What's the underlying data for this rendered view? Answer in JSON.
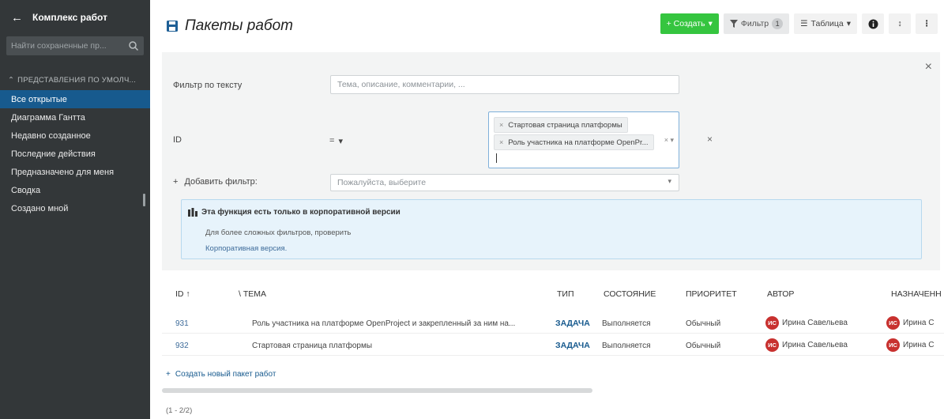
{
  "sidebar": {
    "title": "Комплекс работ",
    "search_placeholder": "Найти сохраненные пр...",
    "section": "ПРЕДСТАВЛЕНИЯ ПО УМОЛЧ...",
    "items": [
      {
        "label": "Все открытые"
      },
      {
        "label": "Диаграмма Гантта"
      },
      {
        "label": "Недавно созданное"
      },
      {
        "label": "Последние действия"
      },
      {
        "label": "Предназначено для меня"
      },
      {
        "label": "Сводка"
      },
      {
        "label": "Создано мной"
      }
    ]
  },
  "header": {
    "title": "Пакеты работ",
    "create_label": "+ Создать",
    "filter_label": "Фильтр",
    "filter_count": "1",
    "view_label": "Таблица"
  },
  "filters": {
    "text_label": "Фильтр по тексту",
    "text_placeholder": "Тема, описание, комментарии, ...",
    "id_label": "ID",
    "operator": "=",
    "id_values": [
      "Стартовая страница платформы",
      "Роль участника на платформе OpenPr..."
    ],
    "add_label": "Добавить фильтр:",
    "add_placeholder": "Пожалуйста, выберите",
    "enterprise_title": "Эта функция есть только в корпоративной версии",
    "enterprise_desc": "Для более сложных фильтров, проверить",
    "enterprise_link": "Корпоративная версия."
  },
  "table": {
    "columns": [
      "ID",
      "ТЕМА",
      "ТИП",
      "СОСТОЯНИЕ",
      "ПРИОРИТЕТ",
      "АВТОР",
      "НАЗНАЧЕНН"
    ],
    "rows": [
      {
        "id": "931",
        "subject": "Роль участника на платформе OpenProject и закрепленный за ним на...",
        "type": "ЗАДАЧА",
        "status": "Выполняется",
        "priority": "Обычный",
        "author": "Ирина Савельева",
        "assignee": "Ирина С",
        "initials": "ИС"
      },
      {
        "id": "932",
        "subject": "Стартовая страница платформы",
        "type": "ЗАДАЧА",
        "status": "Выполняется",
        "priority": "Обычный",
        "author": "Ирина Савельева",
        "assignee": "Ирина С",
        "initials": "ИС"
      }
    ],
    "create_link": "Создать новый пакет работ",
    "pagination": "(1 - 2/2)"
  },
  "colors": {
    "sidebar": "#333739",
    "active": "#175a8e",
    "create": "#35c53f",
    "avatar": "#c8312f"
  }
}
